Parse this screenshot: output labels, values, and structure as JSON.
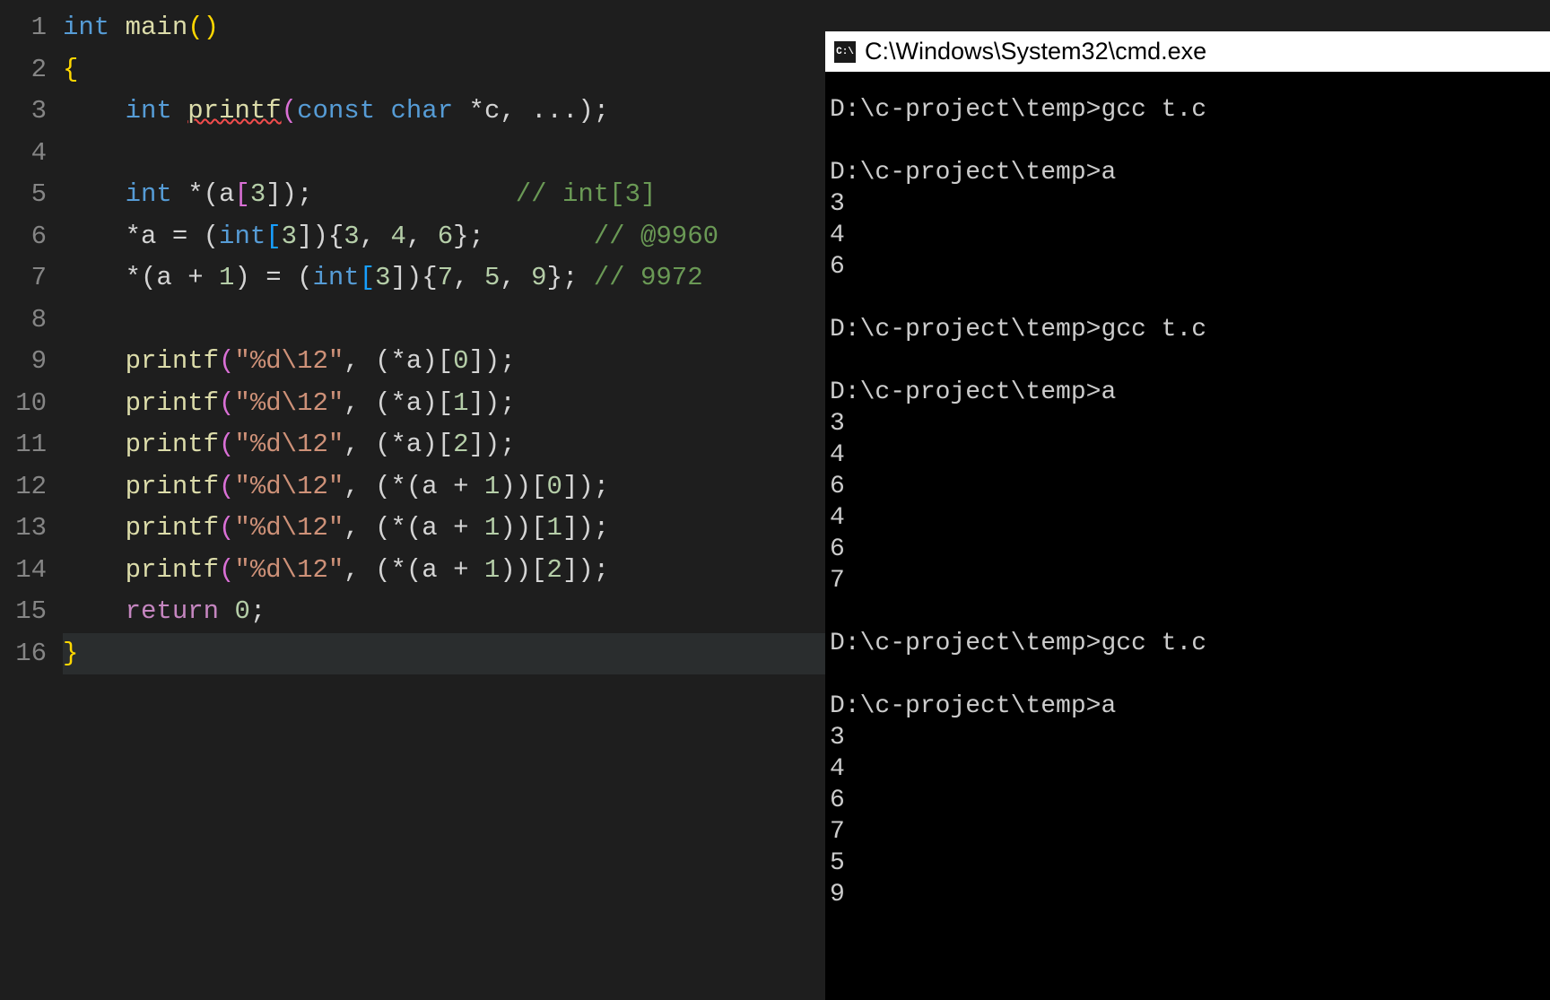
{
  "editor": {
    "lineNumbers": [
      "1",
      "2",
      "3",
      "4",
      "5",
      "6",
      "7",
      "8",
      "9",
      "10",
      "11",
      "12",
      "13",
      "14",
      "15",
      "16"
    ],
    "code": {
      "l1": {
        "kw1": "int",
        "fn": "main",
        "p": "()"
      },
      "l2": {
        "b": "{"
      },
      "l3": {
        "kw1": "int",
        "fn": "printf",
        "p1": "(",
        "kw2": "const",
        "ty": "char",
        "ptr": " *",
        "id": "c",
        "rest": ", ...);"
      },
      "l4": "",
      "l5": {
        "kw1": "int",
        "ptr": " *(",
        "id": "a",
        "br": "[",
        "n": "3",
        "br2": "]);",
        "cm": "// int[3]"
      },
      "l6": {
        "pre": "*a = (",
        "ty": "int",
        "br": "[",
        "n1": "3",
        "br2": "]){",
        "n2": "3",
        "c1": ", ",
        "n3": "4",
        "c2": ", ",
        "n4": "6",
        "end": "};",
        "cm": "// @9960"
      },
      "l7": {
        "pre": "*(a + ",
        "n0": "1",
        "mid": ") = (",
        "ty": "int",
        "br": "[",
        "n1": "3",
        "br2": "]){",
        "n2": "7",
        "c1": ", ",
        "n3": "5",
        "c2": ", ",
        "n4": "9",
        "end": "};",
        "cm": " // 9972"
      },
      "l8": "",
      "l9": {
        "fn": "printf",
        "p1": "(",
        "s": "\"%d\\12\"",
        "c": ", (*a)[",
        "n": "0",
        "end": "]);"
      },
      "l10": {
        "fn": "printf",
        "p1": "(",
        "s": "\"%d\\12\"",
        "c": ", (*a)[",
        "n": "1",
        "end": "]);"
      },
      "l11": {
        "fn": "printf",
        "p1": "(",
        "s": "\"%d\\12\"",
        "c": ", (*a)[",
        "n": "2",
        "end": "]);"
      },
      "l12": {
        "fn": "printf",
        "p1": "(",
        "s": "\"%d\\12\"",
        "c": ", (*(a + ",
        "n0": "1",
        "mid": "))[",
        "n": "0",
        "end": "]);"
      },
      "l13": {
        "fn": "printf",
        "p1": "(",
        "s": "\"%d\\12\"",
        "c": ", (*(a + ",
        "n0": "1",
        "mid": "))[",
        "n": "1",
        "end": "]);"
      },
      "l14": {
        "fn": "printf",
        "p1": "(",
        "s": "\"%d\\12\"",
        "c": ", (*(a + ",
        "n0": "1",
        "mid": "))[",
        "n": "2",
        "end": "]);"
      },
      "l15": {
        "kw": "return",
        "n": "0",
        "end": ";"
      },
      "l16": {
        "b": "}"
      }
    }
  },
  "terminal": {
    "iconText": "C:\\",
    "title": "C:\\Windows\\System32\\cmd.exe",
    "lines": [
      "D:\\c-project\\temp>gcc t.c",
      "",
      "D:\\c-project\\temp>a",
      "3",
      "4",
      "6",
      "",
      "D:\\c-project\\temp>gcc t.c",
      "",
      "D:\\c-project\\temp>a",
      "3",
      "4",
      "6",
      "4",
      "6",
      "7",
      "",
      "D:\\c-project\\temp>gcc t.c",
      "",
      "D:\\c-project\\temp>a",
      "3",
      "4",
      "6",
      "7",
      "5",
      "9"
    ]
  }
}
